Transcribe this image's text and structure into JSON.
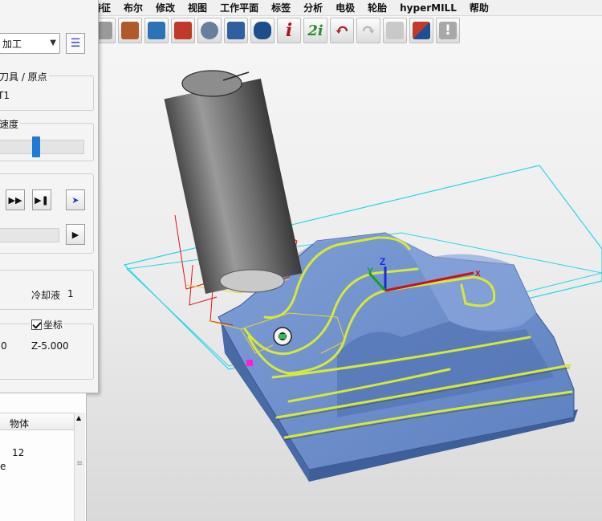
{
  "menu": [
    "特征",
    "布尔",
    "修改",
    "视图",
    "工作平面",
    "标签",
    "分析",
    "电极",
    "轮胎",
    "hyperMILL",
    "帮助"
  ],
  "toolbar": [
    {
      "icon": "open-file-icon",
      "glyph": "",
      "color": "#9a9a9a"
    },
    {
      "icon": "cube-stock-icon",
      "glyph": "",
      "color": "#b05a2b"
    },
    {
      "icon": "turning-tool-icon",
      "glyph": "",
      "color": "#2c73b5"
    },
    {
      "icon": "delete-stock-icon",
      "glyph": "",
      "color": "#c0392b"
    },
    {
      "icon": "gear-icon",
      "glyph": "",
      "color": "#6a7f9c"
    },
    {
      "icon": "tool-count-icon",
      "glyph": "",
      "color": "#2f5f9f"
    },
    {
      "icon": "cylinder-icon",
      "glyph": "",
      "color": "#1d4e8c"
    },
    {
      "icon": "info-icon",
      "glyph": "i",
      "color": "#b0121b"
    },
    {
      "icon": "info-2-icon",
      "glyph": "2i",
      "color": "#2e8b2e"
    },
    {
      "icon": "undo-icon",
      "glyph": "↶",
      "color": "#a5252a"
    },
    {
      "icon": "redo-icon",
      "glyph": "↷",
      "color": "#b7b7b7"
    },
    {
      "icon": "filter-icon",
      "glyph": "",
      "color": "#c9c9c9"
    },
    {
      "icon": "box-view-icon",
      "glyph": "",
      "color": "#c0392b"
    },
    {
      "icon": "warning-icon",
      "glyph": "!",
      "color": "#a8a8a8"
    }
  ],
  "simulation": {
    "mode_value": "加工",
    "tool_origin_title": "刀具 / 原点",
    "tool_value": "T1",
    "speed_title": "速度",
    "speed_level": 0.42,
    "coolant_label": "冷却液",
    "coolant_value": "1",
    "coords_label": "坐标",
    "x_value": "0",
    "z_value": "Z-5.000"
  },
  "objects": {
    "column": "物体",
    "row_value": "12",
    "row_text": "e"
  }
}
